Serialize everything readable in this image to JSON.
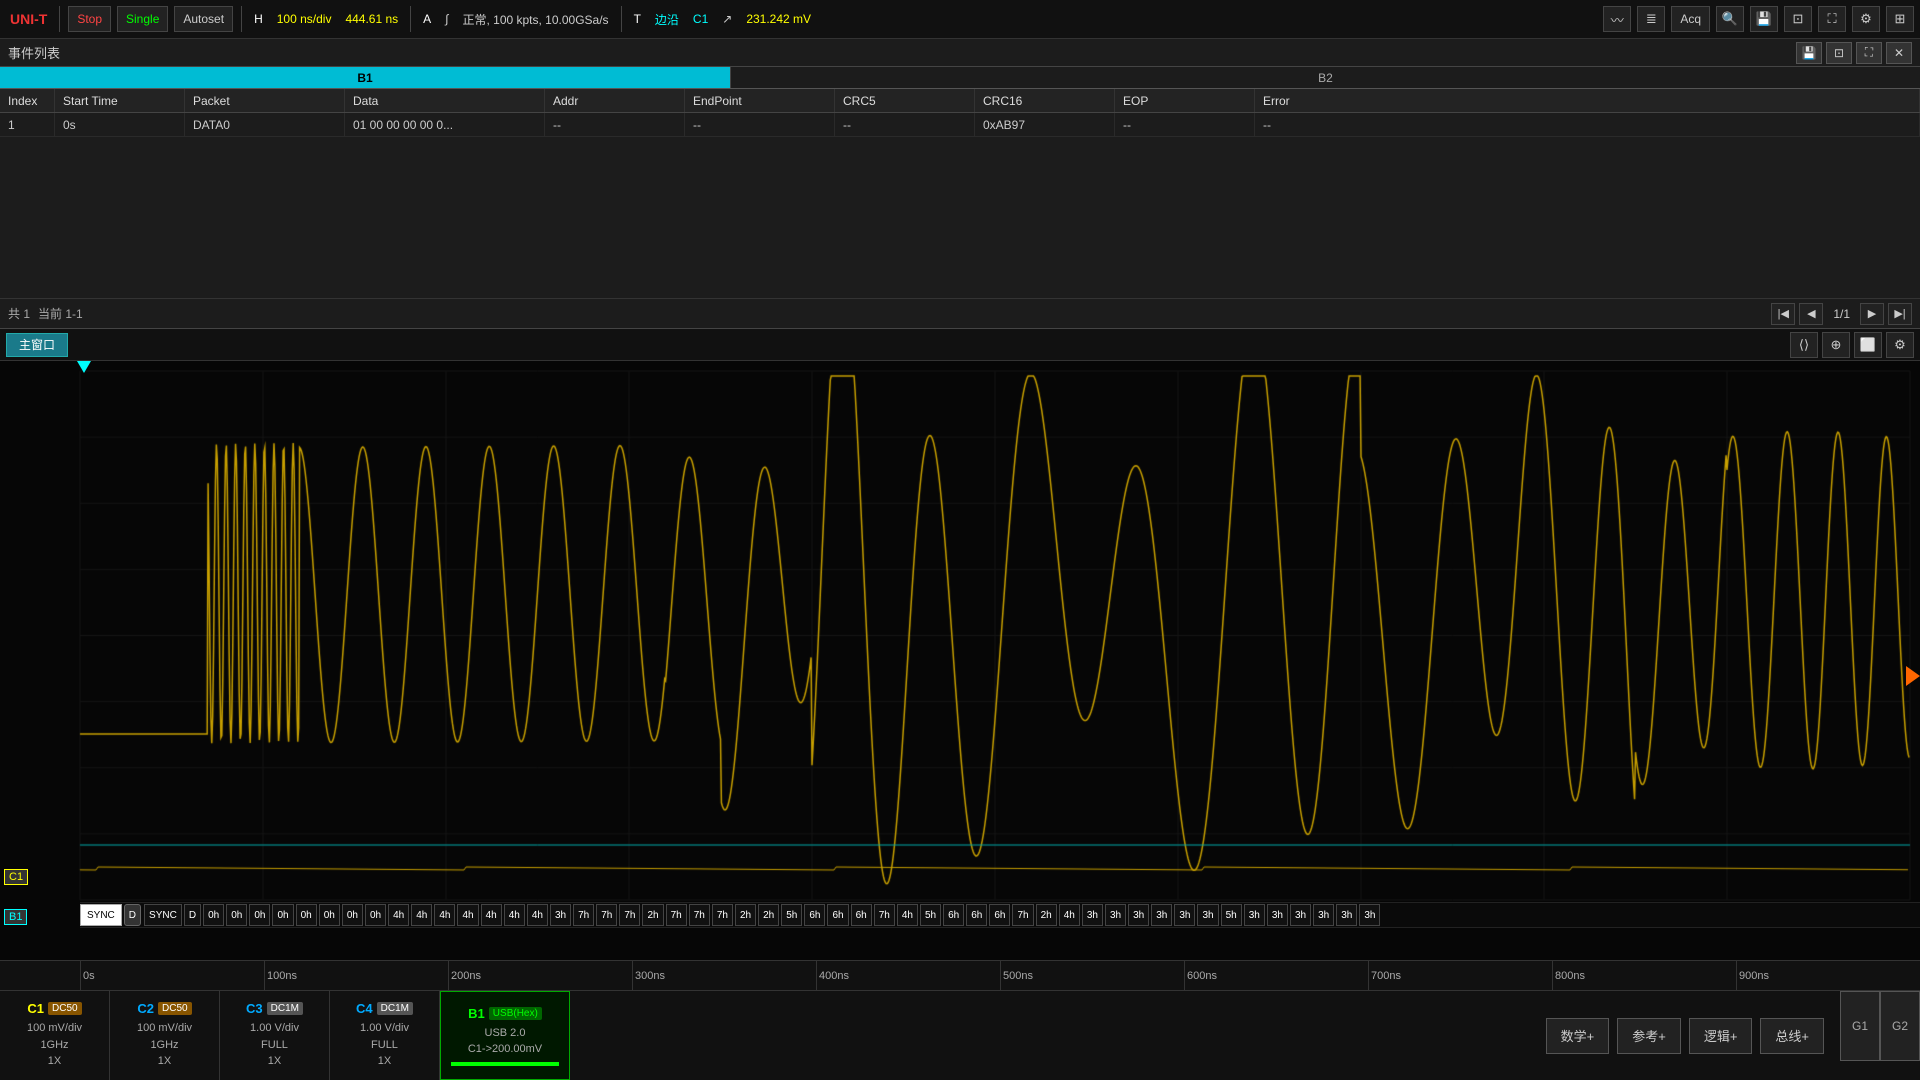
{
  "brand": {
    "logo": "UNI-T",
    "logo_color": "#e33"
  },
  "toolbar": {
    "stop_label": "Stop",
    "single_label": "Single",
    "autoset_label": "Autoset",
    "h_label": "H",
    "time_div": "100 ns/div",
    "delay": "444.61 ns",
    "a_label": "A",
    "wave_icon": "∫",
    "wave_info": "正常, 100 kpts, 10.00GSa/s",
    "t_label": "T",
    "edge_label": "边沿",
    "ch_label": "C1",
    "slope_icon": "↗",
    "trigger_val": "231.242 mV",
    "acq_label": "Acq",
    "icons": [
      "⟳",
      "≋",
      "🔍",
      "💾",
      "⊡",
      "⛶",
      "⚙",
      "⊞"
    ]
  },
  "events": {
    "title": "事件列表",
    "bus1_label": "B1",
    "bus2_label": "B2",
    "columns": [
      "Index",
      "Start Time",
      "Packet",
      "Data",
      "Addr",
      "EndPoint",
      "CRC5",
      "CRC16",
      "EOP",
      "Error"
    ],
    "rows": [
      {
        "index": "1",
        "start_time": "0s",
        "packet": "DATA0",
        "data": "01 00 00 00 00 0...",
        "addr": "--",
        "endpoint": "--",
        "crc5": "--",
        "crc16": "0xAB97",
        "eop": "--",
        "error": "--"
      }
    ],
    "footer_total": "共 1",
    "footer_current": "当前 1-1",
    "page_current": "1/1"
  },
  "waveform": {
    "tab_label": "主窗口",
    "time_labels": [
      "0s",
      "100ns",
      "200ns",
      "300ns",
      "400ns",
      "500ns",
      "600ns",
      "700ns",
      "800ns",
      "900ns"
    ],
    "c1_label": "C1",
    "b1_label": "B1",
    "decode_tokens": [
      "SYNC",
      "D",
      "0h",
      "0h",
      "0h",
      "0h",
      "0h",
      "0h",
      "0h",
      "0h",
      "4h",
      "4h",
      "4h",
      "4h",
      "4h",
      "4h",
      "4h",
      "3h",
      "7h",
      "7h",
      "7h",
      "2h",
      "7h",
      "7h",
      "7h",
      "2h",
      "2h",
      "5h",
      "6h",
      "6h",
      "6h",
      "7h",
      "4h",
      "5h",
      "6h",
      "6h",
      "6h",
      "7h",
      "2h",
      "4h",
      "3h",
      "3h",
      "3h",
      "3h",
      "3h",
      "3h",
      "5h",
      "3h",
      "3h",
      "3h",
      "3h",
      "3h",
      "3h"
    ]
  },
  "channels": {
    "c1": {
      "name": "C1",
      "badge": "DC50",
      "line1": "100 mV/div",
      "line2": "1GHz",
      "line3": "1X"
    },
    "c2": {
      "name": "C2",
      "badge": "DC50",
      "line1": "100 mV/div",
      "line2": "1GHz",
      "line3": "1X"
    },
    "c3": {
      "name": "C3",
      "badge": "DC1M",
      "line1": "1.00 V/div",
      "line2": "FULL",
      "line3": "1X"
    },
    "c4": {
      "name": "C4",
      "badge": "DC1M",
      "line1": "1.00 V/div",
      "line2": "FULL",
      "line3": "1X"
    },
    "b1": {
      "name": "B1",
      "badge": "USB(Hex)",
      "line1": "USB 2.0",
      "line2": "C1->200.00mV"
    },
    "buttons": [
      "数学+",
      "参考+",
      "逻辑+",
      "总线+"
    ],
    "g1_label": "G1",
    "g2_label": "G2"
  }
}
